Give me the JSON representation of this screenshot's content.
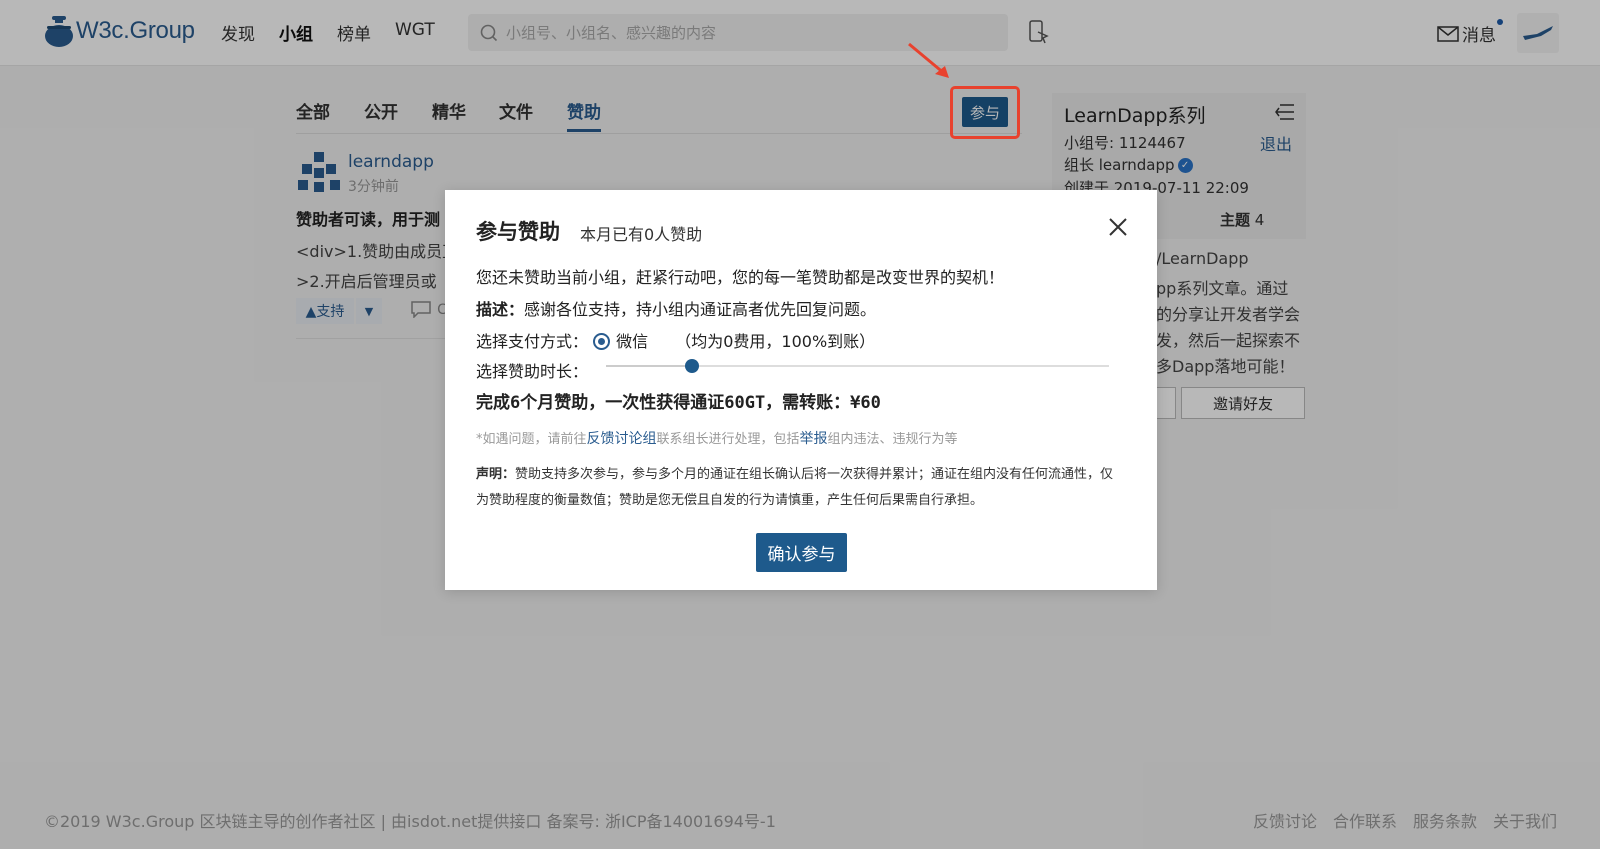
{
  "header": {
    "logo_text": "W3c.Group",
    "nav": [
      "发现",
      "小组",
      "榜单",
      "WGT"
    ],
    "nav_active_index": 1,
    "search_placeholder": "小组号、小组名、感兴趣的内容",
    "messages_label": "消息"
  },
  "tabs": {
    "items": [
      "全部",
      "公开",
      "精华",
      "文件",
      "赞助"
    ],
    "active_index": 4,
    "join_label": "参与"
  },
  "post": {
    "user": "learndapp",
    "time": "3分钟前",
    "title": "赞助者可读，用于测",
    "line1": "<div>1.赞助由成员直",
    "line2": ">2.开启后管理员或",
    "vote_up_label": "▲支持",
    "vote_down_label": "▼",
    "comment_count": "C"
  },
  "side": {
    "title": "LearnDapp系列",
    "group_no": "小组号: 1124467",
    "exit_label": "退出",
    "leader": "组长 learndapp",
    "created": "创建于 2019-07-11 22:09",
    "topic_label": "主题",
    "topic_count": "4",
    "desc": [
      "/LearnDapp",
      "pp系列文章。通过",
      "的分享让开发者学会",
      "发，然后一起探索不",
      "多Dapp落地可能！"
    ],
    "invite_label": "邀请好友"
  },
  "footer": {
    "left": "©2019 W3c.Group 区块链主导的创作者社区  |  由isdot.net提供接口 备案号: 浙ICP备14001694号-1",
    "links": [
      "反馈讨论",
      "合作联系",
      "服务条款",
      "关于我们"
    ]
  },
  "modal": {
    "title": "参与赞助",
    "subtitle": "本月已有0人赞助",
    "intro": "您还未赞助当前小组，赶紧行动吧，您的每一笔赞助都是改变世界的契机！",
    "desc_label": "描述：",
    "desc_text": "感谢各位支持，持小组内通证高者优先回复问题。",
    "pay_label": "选择支付方式：",
    "pay_option": "微信",
    "pay_note": "（均为0费用，100%到账）",
    "duration_label": "选择赞助时长：",
    "duration_fraction": 0.17,
    "total": "完成6个月赞助，一次性获得通证60GT，需转账：¥60",
    "hint_pre": "*如遇问题，请前往",
    "hint_link1": "反馈讨论组",
    "hint_mid": "联系组长进行处理，包括",
    "hint_link2": "举报",
    "hint_post": "组内违法、违规行为等",
    "decl_label": "声明：",
    "decl_text": "赞助支持多次参与，参与多个月的通证在组长确认后将一次获得并累计；通证在组内没有任何流通性，仅为赞助程度的衡量数值；赞助是您无偿且自发的行为请慎重，产生任何后果需自行承担。",
    "confirm_label": "确认参与"
  },
  "colors": {
    "primary": "#1e5a8c",
    "highlight": "#e8422e"
  }
}
